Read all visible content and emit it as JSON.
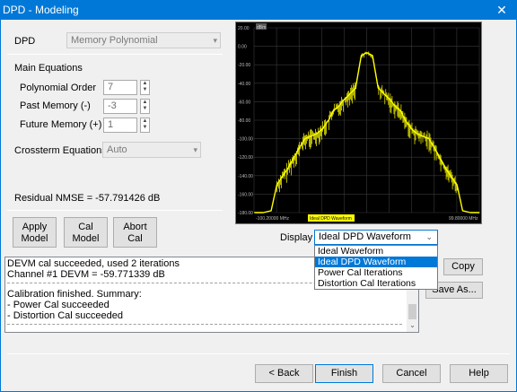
{
  "window": {
    "title": "DPD - Modeling",
    "close_glyph": "✕"
  },
  "dpd": {
    "label": "DPD",
    "value": "Memory Polynomial"
  },
  "main_equations": {
    "heading": "Main Equations",
    "polynomial_order": {
      "label": "Polynomial Order",
      "value": "7"
    },
    "past_memory": {
      "label": "Past Memory (-)",
      "value": "-3"
    },
    "future_memory": {
      "label": "Future Memory (+)",
      "value": "1"
    }
  },
  "crossterm": {
    "label": "Crossterm Equations",
    "value": "Auto"
  },
  "residual_nmse": "Residual NMSE = -57.791426 dB",
  "buttons": {
    "apply_model": [
      "Apply",
      "Model"
    ],
    "cal_model": [
      "Cal",
      "Model"
    ],
    "abort_cal": [
      "Abort",
      "Cal"
    ],
    "copy": "Copy",
    "save_as": "Save As...",
    "back": "< Back",
    "finish": "Finish",
    "cancel": "Cancel",
    "help": "Help"
  },
  "chart": {
    "y_ticks": [
      "20.00",
      "0.00",
      "-20.00",
      "-40.00",
      "-60.00",
      "-80.00",
      "-100.00",
      "-120.00",
      "-140.00",
      "-160.00",
      "-180.00"
    ],
    "x_start": "-100.20000 MHz",
    "x_end": "99.80000 MHz",
    "trace_label": "Ideal DPD Waveform",
    "corner_tag": "dBm",
    "trace_color": "#ffff00",
    "grid_color": "#3a3a3a"
  },
  "chart_data": {
    "type": "line",
    "series": [
      {
        "name": "Ideal DPD Waveform",
        "x": [
          -100,
          -92,
          -85,
          -80,
          -70,
          -60,
          -55,
          -45,
          -40,
          -34,
          -30,
          -25,
          -22,
          -18,
          -14,
          -10,
          -5,
          0,
          5,
          10,
          14,
          18,
          22,
          25,
          30,
          34,
          40,
          45,
          55,
          60,
          70,
          80,
          85,
          92,
          100
        ],
        "y": [
          -182,
          -182,
          -178,
          -150,
          -132,
          -110,
          -100,
          -95,
          -90,
          -80,
          -70,
          -65,
          -60,
          -55,
          -50,
          -45,
          -10,
          -7,
          -10,
          -45,
          -50,
          -55,
          -60,
          -65,
          -70,
          -80,
          -90,
          -95,
          -100,
          -110,
          -132,
          -150,
          -178,
          -182,
          -182
        ]
      }
    ],
    "xlim": [
      -100.2,
      99.8
    ],
    "ylim": [
      -180,
      20
    ],
    "grid": true,
    "legend": "bottom-center"
  },
  "display": {
    "label": "Display",
    "selected": "Ideal DPD Waveform",
    "options": [
      "Ideal Waveform",
      "Ideal DPD Waveform",
      "Power Cal Iterations",
      "Distortion Cal Iterations"
    ],
    "highlighted_index": 1
  },
  "log": {
    "lines": [
      "DEVM cal succeeded, used 2 iterations",
      "Channel #1 DEVM = -59.771339 dB",
      "Calibration finished. Summary:",
      "- Power Cal succeeded",
      "- Distortion Cal succeeded"
    ]
  }
}
